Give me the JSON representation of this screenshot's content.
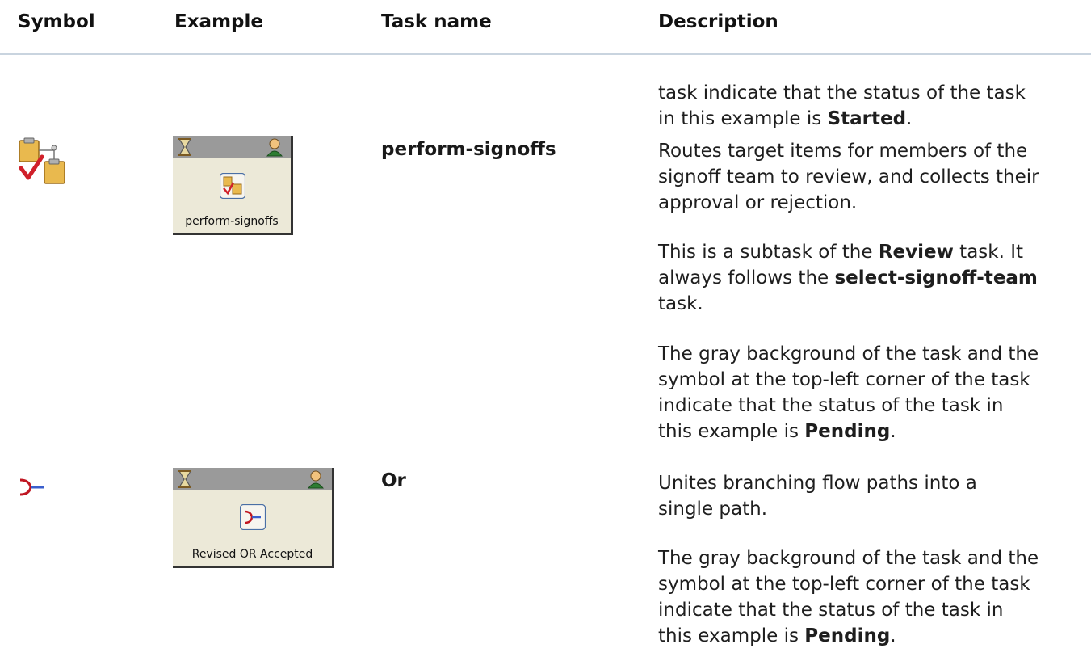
{
  "headers": {
    "symbol": "Symbol",
    "example": "Example",
    "task_name": "Task name",
    "description": "Description"
  },
  "continuation": {
    "text_a": "task indicate that the status of the task",
    "text_b": "in this example is ",
    "status": "Started",
    "tail": "."
  },
  "rows": [
    {
      "symbol_icon": "signoff-clipboard-icon",
      "example_caption": "perform-signoffs",
      "task_name": "perform-signoffs",
      "p1_lines": [
        "Routes target items for members of the",
        "signoff team to review, and collects their",
        "approval or rejection."
      ],
      "p2": {
        "a": "This is a subtask of the ",
        "b": "Review",
        "c": " task. It",
        "d": "always follows the ",
        "e": "select-signoff-team",
        "f": "task."
      },
      "p3_lines": [
        "The gray background of the task and the",
        "symbol at the top-left corner of the task",
        "indicate that the status of the task in",
        "this example is "
      ],
      "status": "Pending",
      "tail": "."
    },
    {
      "symbol_icon": "or-merge-icon",
      "example_caption": "Revised OR Accepted",
      "task_name": "Or",
      "p1_lines": [
        "Unites branching flow paths into a",
        "single path."
      ],
      "p3_lines": [
        "The gray background of the task and the",
        "symbol at the top-left corner of the task",
        "indicate that the status of the task in",
        "this example is "
      ],
      "status": "Pending",
      "tail": "."
    }
  ]
}
